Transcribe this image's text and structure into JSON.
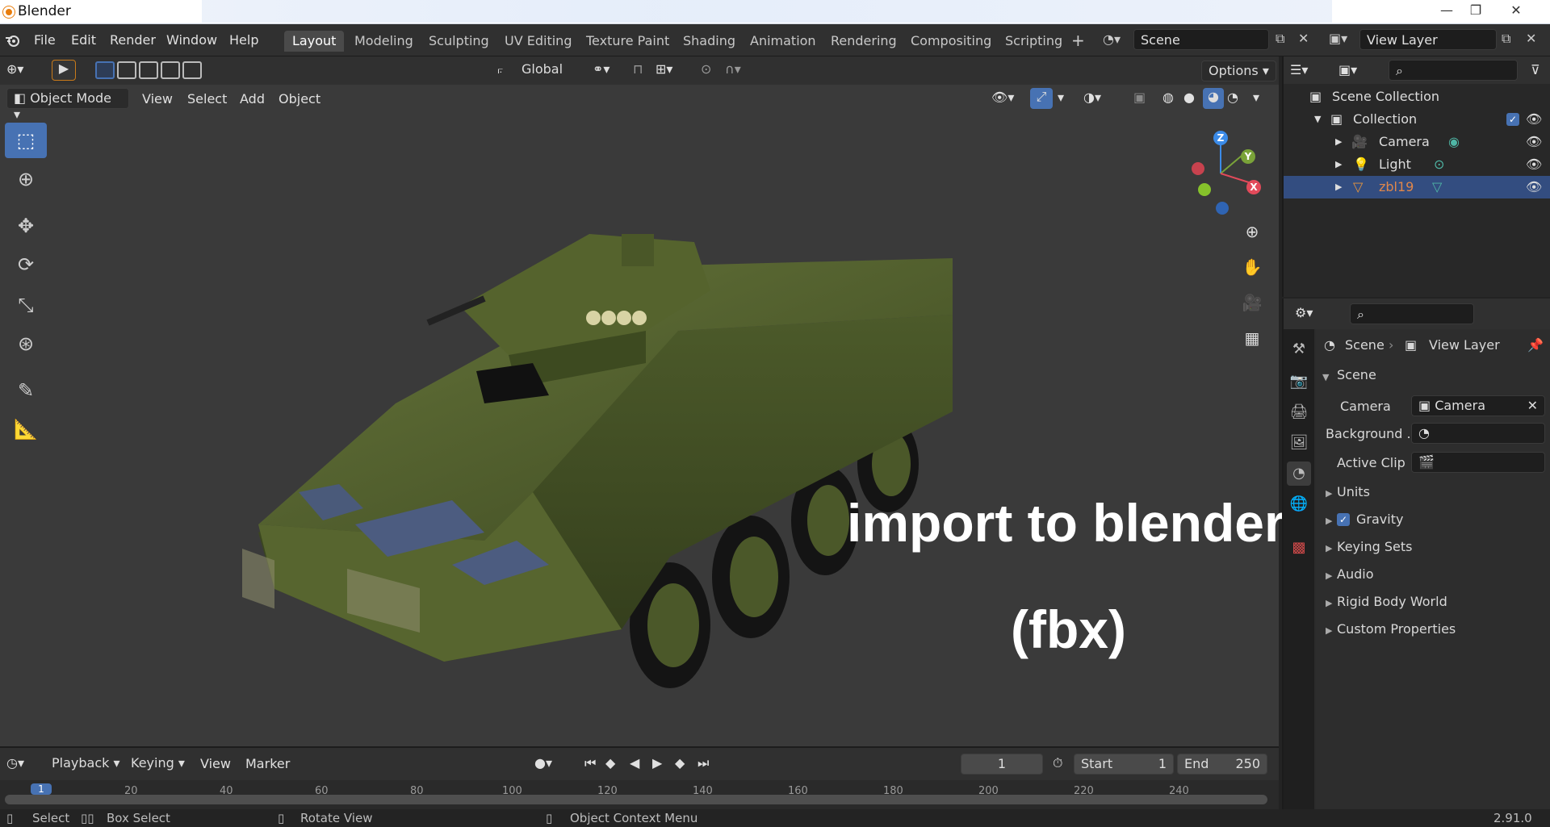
{
  "window": {
    "title": "Blender",
    "min": "—",
    "restore": "❐",
    "close": "✕"
  },
  "menu": {
    "file": "File",
    "edit": "Edit",
    "render": "Render",
    "window": "Window",
    "help": "Help"
  },
  "workspaces": [
    "Layout",
    "Modeling",
    "Sculpting",
    "UV Editing",
    "Texture Paint",
    "Shading",
    "Animation",
    "Rendering",
    "Compositing",
    "Scripting"
  ],
  "add_workspace": "+",
  "scene_field": "Scene",
  "view_layer_field": "View Layer",
  "viewport": {
    "transform_orientation": "Global",
    "options": "Options",
    "mode": "Object Mode",
    "menus": {
      "view": "View",
      "select": "Select",
      "add": "Add",
      "object": "Object"
    },
    "overlay_line1": "import to blender",
    "overlay_line2": "(fbx)",
    "gizmo": {
      "x": "X",
      "y": "Y",
      "z": "Z"
    }
  },
  "timeline": {
    "playback": "Playback",
    "keying": "Keying",
    "view": "View",
    "marker": "Marker",
    "current_frame": "1",
    "start_label": "Start",
    "start": "1",
    "end_label": "End",
    "end": "250",
    "ticks": [
      "1",
      "20",
      "40",
      "60",
      "80",
      "100",
      "120",
      "140",
      "160",
      "180",
      "200",
      "220",
      "240"
    ]
  },
  "status": {
    "select": "Select",
    "box_select": "Box Select",
    "rotate_view": "Rotate View",
    "context_menu": "Object Context Menu",
    "version": "2.91.0"
  },
  "outliner": {
    "scene_collection": "Scene Collection",
    "collection": "Collection",
    "items": [
      {
        "name": "Camera",
        "color": "#dddddd"
      },
      {
        "name": "Light",
        "color": "#dddddd"
      },
      {
        "name": "zbl19",
        "color": "#e0874a"
      }
    ]
  },
  "properties": {
    "breadcrumb_scene": "Scene",
    "breadcrumb_view_layer": "View Layer",
    "panel": "Scene",
    "camera_label": "Camera",
    "camera_value": "Camera",
    "background_label": "Background ...",
    "active_clip_label": "Active Clip",
    "sections": [
      "Units",
      "Gravity",
      "Keying Sets",
      "Audio",
      "Rigid Body World",
      "Custom Properties"
    ]
  },
  "colors": {
    "accent": "#4772b3",
    "selected_row": "#334d80",
    "object_orange": "#e0874a"
  }
}
